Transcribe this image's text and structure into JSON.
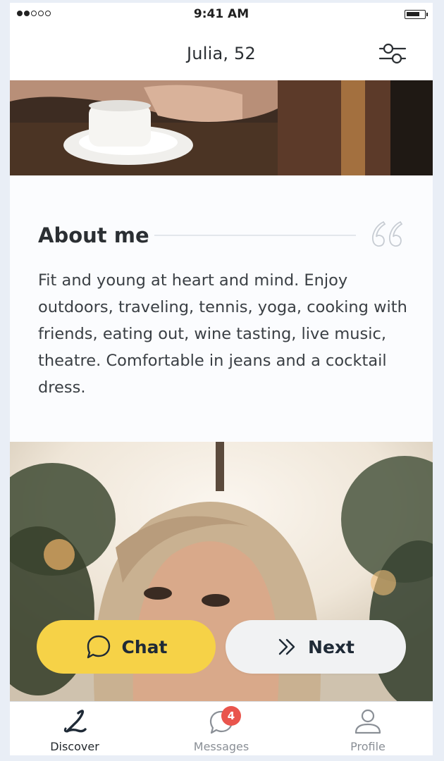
{
  "status_bar": {
    "time": "9:41 AM"
  },
  "header": {
    "title": "Julia, 52"
  },
  "about": {
    "title": "About me",
    "text": "Fit and young at heart and mind. Enjoy outdoors, traveling, tennis, yoga, cooking with friends, eating out, wine tasting, live music, theatre. Comfortable in jeans and a cocktail dress."
  },
  "actions": {
    "chat_label": "Chat",
    "next_label": "Next"
  },
  "tabbar": {
    "items": [
      {
        "label": "Discover"
      },
      {
        "label": "Messages",
        "badge": "4"
      },
      {
        "label": "Profile"
      }
    ]
  },
  "colors": {
    "chat_button": "#f6d247",
    "next_button": "#f1f2f3",
    "badge": "#e9554d",
    "text": "#2b2f33"
  },
  "icons": {
    "filter": "sliders-icon",
    "quote": "quote-icon",
    "chat": "speech-bubble-icon",
    "next": "double-chevron-right-icon",
    "discover": "script-l-logo-icon",
    "messages": "speech-bubble-icon",
    "profile": "person-icon"
  }
}
